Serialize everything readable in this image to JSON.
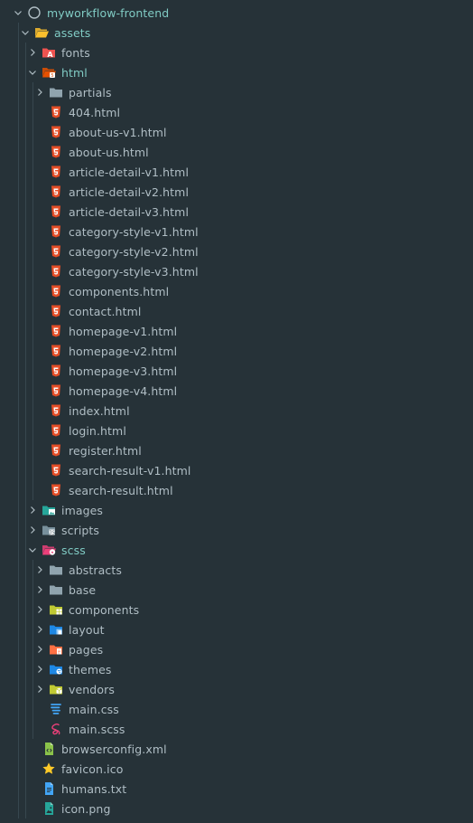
{
  "explorer": {
    "items": [
      {
        "label": "myworkflow-frontend",
        "depth": 0,
        "chevron": "down",
        "icon": "repo-circle-icon",
        "accent": true
      },
      {
        "label": "assets",
        "depth": 1,
        "chevron": "down",
        "icon": "folder-open-yellow-icon",
        "accent": true
      },
      {
        "label": "fonts",
        "depth": 2,
        "chevron": "right",
        "icon": "folder-fonts-icon"
      },
      {
        "label": "html",
        "depth": 2,
        "chevron": "down",
        "icon": "folder-html-open-icon",
        "accent": true
      },
      {
        "label": "partials",
        "depth": 3,
        "chevron": "right",
        "icon": "folder-gray-icon"
      },
      {
        "label": "404.html",
        "depth": 3,
        "icon": "html5-icon"
      },
      {
        "label": "about-us-v1.html",
        "depth": 3,
        "icon": "html5-icon"
      },
      {
        "label": "about-us.html",
        "depth": 3,
        "icon": "html5-icon"
      },
      {
        "label": "article-detail-v1.html",
        "depth": 3,
        "icon": "html5-icon"
      },
      {
        "label": "article-detail-v2.html",
        "depth": 3,
        "icon": "html5-icon"
      },
      {
        "label": "article-detail-v3.html",
        "depth": 3,
        "icon": "html5-icon"
      },
      {
        "label": "category-style-v1.html",
        "depth": 3,
        "icon": "html5-icon"
      },
      {
        "label": "category-style-v2.html",
        "depth": 3,
        "icon": "html5-icon"
      },
      {
        "label": "category-style-v3.html",
        "depth": 3,
        "icon": "html5-icon"
      },
      {
        "label": "components.html",
        "depth": 3,
        "icon": "html5-icon"
      },
      {
        "label": "contact.html",
        "depth": 3,
        "icon": "html5-icon"
      },
      {
        "label": "homepage-v1.html",
        "depth": 3,
        "icon": "html5-icon"
      },
      {
        "label": "homepage-v2.html",
        "depth": 3,
        "icon": "html5-icon"
      },
      {
        "label": "homepage-v3.html",
        "depth": 3,
        "icon": "html5-icon"
      },
      {
        "label": "homepage-v4.html",
        "depth": 3,
        "icon": "html5-icon"
      },
      {
        "label": "index.html",
        "depth": 3,
        "icon": "html5-icon"
      },
      {
        "label": "login.html",
        "depth": 3,
        "icon": "html5-icon"
      },
      {
        "label": "register.html",
        "depth": 3,
        "icon": "html5-icon"
      },
      {
        "label": "search-result-v1.html",
        "depth": 3,
        "icon": "html5-icon"
      },
      {
        "label": "search-result.html",
        "depth": 3,
        "icon": "html5-icon"
      },
      {
        "label": "images",
        "depth": 2,
        "chevron": "right",
        "icon": "folder-images-icon"
      },
      {
        "label": "scripts",
        "depth": 2,
        "chevron": "right",
        "icon": "folder-scripts-icon"
      },
      {
        "label": "scss",
        "depth": 2,
        "chevron": "down",
        "icon": "folder-sass-open-icon",
        "accent": true
      },
      {
        "label": "abstracts",
        "depth": 3,
        "chevron": "right",
        "icon": "folder-gray-icon"
      },
      {
        "label": "base",
        "depth": 3,
        "chevron": "right",
        "icon": "folder-gray-icon"
      },
      {
        "label": "components",
        "depth": 3,
        "chevron": "right",
        "icon": "folder-components-icon"
      },
      {
        "label": "layout",
        "depth": 3,
        "chevron": "right",
        "icon": "folder-layout-icon"
      },
      {
        "label": "pages",
        "depth": 3,
        "chevron": "right",
        "icon": "folder-pages-icon"
      },
      {
        "label": "themes",
        "depth": 3,
        "chevron": "right",
        "icon": "folder-themes-icon"
      },
      {
        "label": "vendors",
        "depth": 3,
        "chevron": "right",
        "icon": "folder-vendors-icon"
      },
      {
        "label": "main.css",
        "depth": 3,
        "icon": "css3-icon"
      },
      {
        "label": "main.scss",
        "depth": 3,
        "icon": "sass-icon"
      },
      {
        "label": "browserconfig.xml",
        "depth": 2,
        "icon": "xml-icon"
      },
      {
        "label": "favicon.ico",
        "depth": 2,
        "icon": "star-favicon-icon"
      },
      {
        "label": "humans.txt",
        "depth": 2,
        "icon": "text-file-icon"
      },
      {
        "label": "icon.png",
        "depth": 2,
        "icon": "image-file-icon"
      }
    ]
  },
  "colors": {
    "background": "#263238",
    "text": "#b0bec5",
    "accent": "#80cbc4",
    "html": "#e44d26",
    "css": "#42a5f5",
    "sass": "#ec407a",
    "folder_gray": "#90a4ae",
    "folder_yellow": "#fbc02d"
  }
}
